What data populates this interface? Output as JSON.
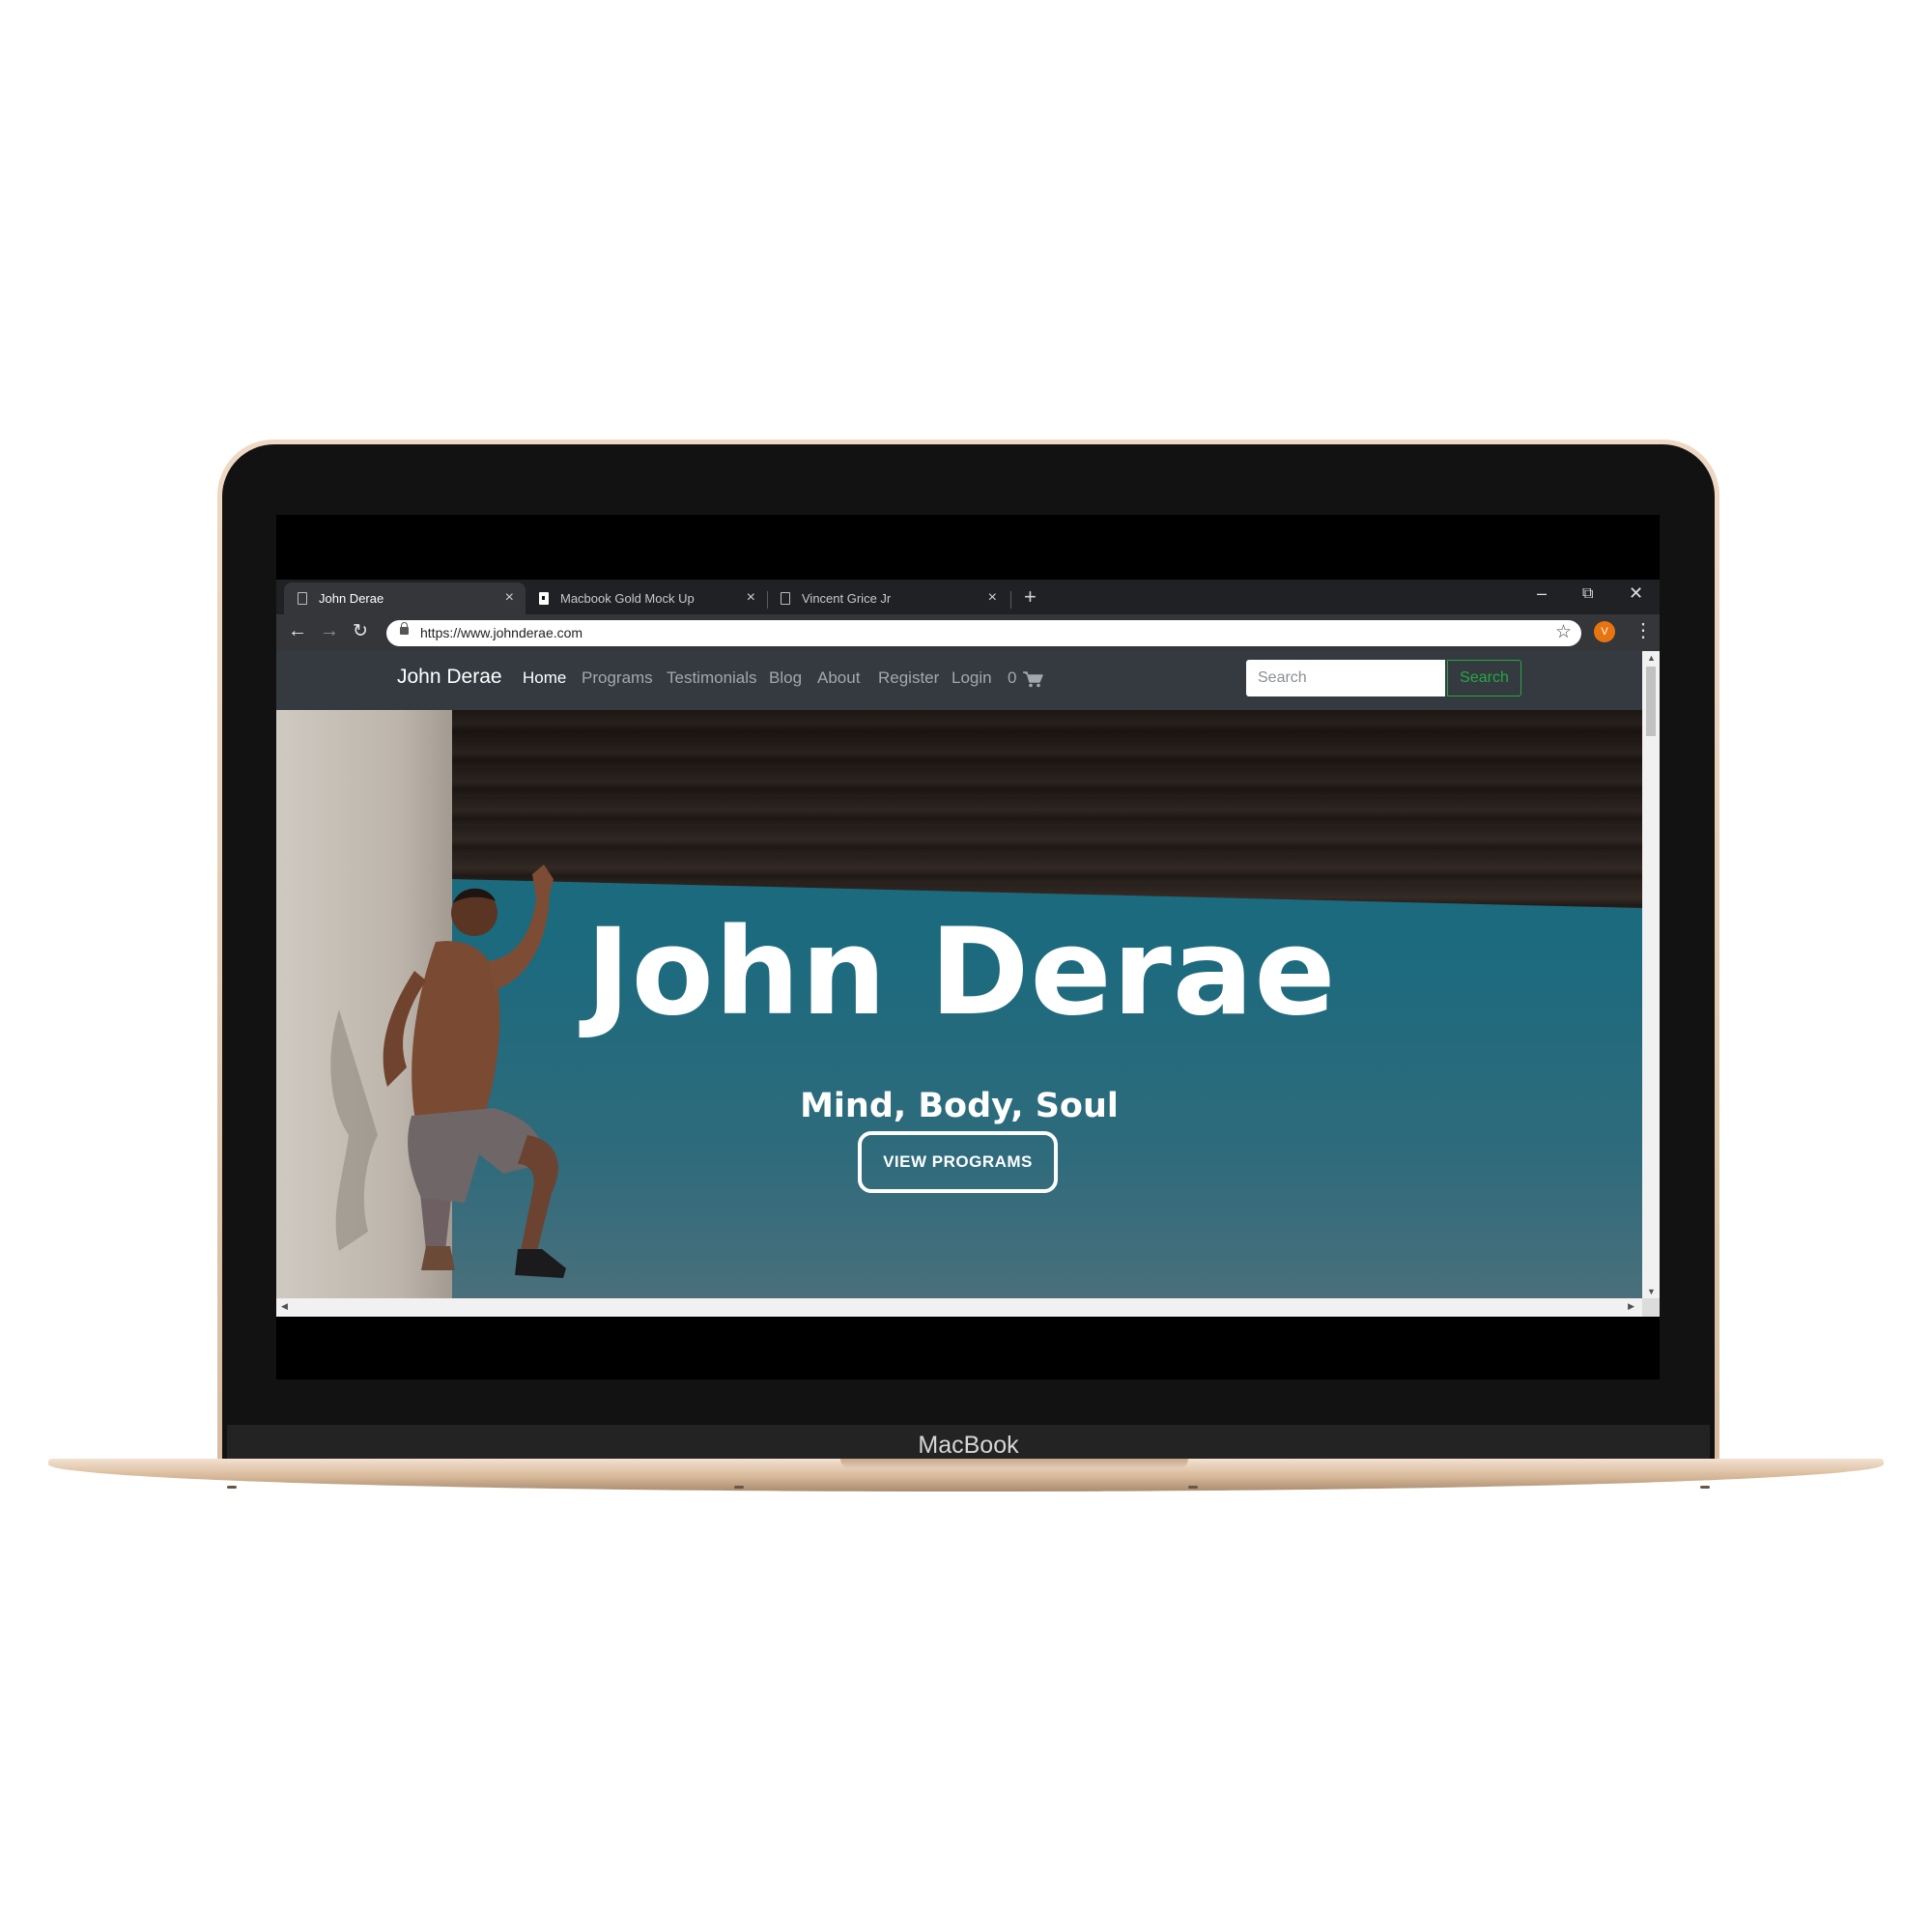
{
  "device": {
    "label": "MacBook"
  },
  "browser": {
    "tabs": [
      {
        "title": "John Derae",
        "active": true,
        "icon": "page-icon"
      },
      {
        "title": "Macbook Gold Mock Up",
        "active": false,
        "icon": "app-icon"
      },
      {
        "title": "Vincent Grice Jr",
        "active": false,
        "icon": "page-icon"
      }
    ],
    "new_tab": "+",
    "window_controls": {
      "minimize": "–",
      "restore": "⧉",
      "close": "✕"
    },
    "tab_close": "×",
    "url": "https://www.johnderae.com",
    "profile_initial": "V",
    "profile_color": "#e8740f"
  },
  "site": {
    "brand": "John Derae",
    "nav": [
      {
        "label": "Home",
        "active": true
      },
      {
        "label": "Programs",
        "active": false
      },
      {
        "label": "Testimonials",
        "active": false
      },
      {
        "label": "Blog",
        "active": false
      },
      {
        "label": "About",
        "active": false
      },
      {
        "label": "Register",
        "active": false
      },
      {
        "label": "Login",
        "active": false
      }
    ],
    "cart_count": "0",
    "search": {
      "placeholder": "Search",
      "button": "Search"
    },
    "colors": {
      "navbar": "#343a40",
      "search_accent": "#28a745"
    }
  },
  "hero": {
    "title": "John Derae",
    "subtitle": "Mind, Body, Soul",
    "cta": "VIEW PROGRAMS"
  }
}
